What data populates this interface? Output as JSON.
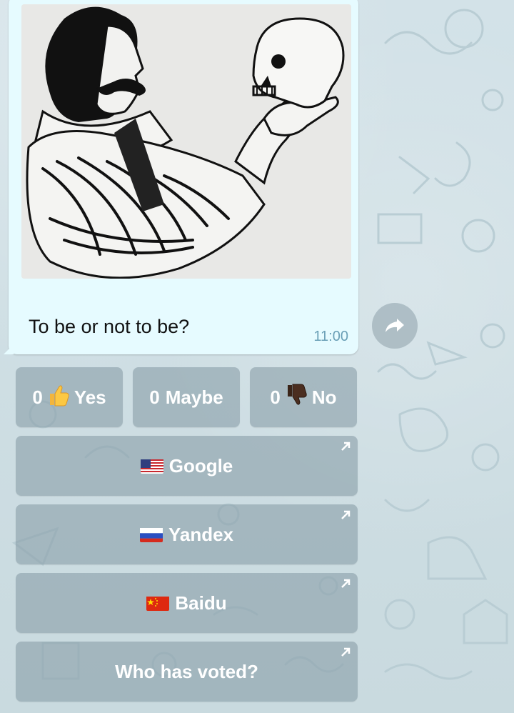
{
  "message": {
    "caption": "To be or not to be?",
    "time": "11:00"
  },
  "votes": [
    {
      "count": "0",
      "icon": "thumbs-up-icon",
      "label": "Yes"
    },
    {
      "count": "0",
      "icon": "",
      "label": "Maybe"
    },
    {
      "count": "0",
      "icon": "thumbs-down-icon",
      "label": "No"
    }
  ],
  "links": [
    {
      "flag": "us-flag-icon",
      "label": "Google"
    },
    {
      "flag": "ru-flag-icon",
      "label": "Yandex"
    },
    {
      "flag": "cn-flag-icon",
      "label": "Baidu"
    }
  ],
  "who_voted": {
    "label": "Who has voted?"
  },
  "colors": {
    "bubble": "#e6fbff",
    "time": "#6a9fb6",
    "button": "#8ba0aa",
    "wallpaper": "#cfdfe5"
  }
}
